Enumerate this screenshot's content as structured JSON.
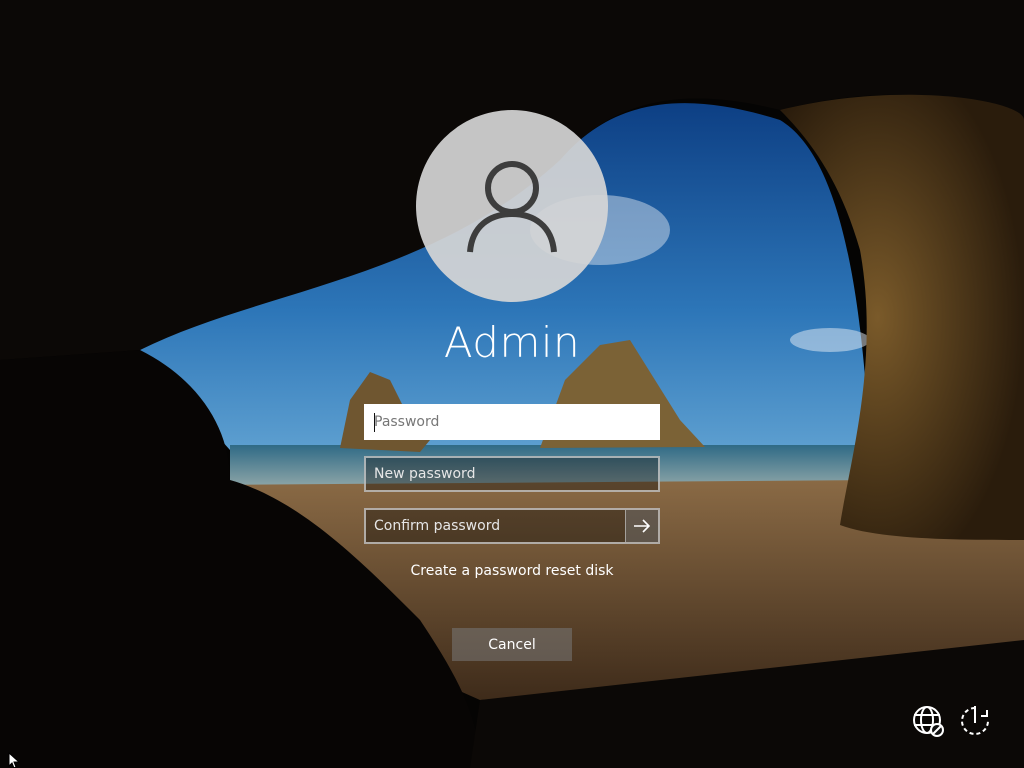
{
  "user": {
    "name": "Admin"
  },
  "form": {
    "password_placeholder": "Password",
    "new_password_placeholder": "New password",
    "confirm_password_placeholder": "Confirm password",
    "reset_disk_link": "Create a password reset disk",
    "cancel_label": "Cancel"
  },
  "icons": {
    "avatar": "user-silhouette-icon",
    "submit": "arrow-right-icon",
    "accessibility": "ease-of-access-icon",
    "language": "network-globe-icon",
    "power": "power-icon",
    "cursor": "mouse-pointer-icon"
  },
  "colors": {
    "field_border": "#d2d2d2",
    "active_field_bg": "#ffffff",
    "button_bg": "#787878"
  }
}
